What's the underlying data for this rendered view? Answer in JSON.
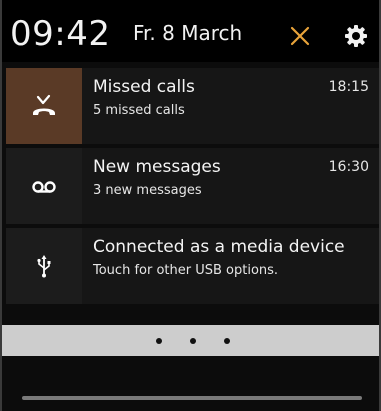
{
  "status": {
    "time": "09:42",
    "date": "Fr. 8 March",
    "accent_color": "#e8a33a"
  },
  "notifications": [
    {
      "icon": "missed-call-icon",
      "title": "Missed calls",
      "subtitle": "5 missed calls",
      "time": "18:15",
      "highlight_color": "#5a3a26"
    },
    {
      "icon": "voicemail-icon",
      "title": "New messages",
      "subtitle": "3 new messages",
      "time": "16:30"
    },
    {
      "icon": "usb-icon",
      "title": "Connected as a media device",
      "subtitle": "Touch for other USB options.",
      "time": ""
    }
  ],
  "pager": {
    "page_count": 3
  }
}
